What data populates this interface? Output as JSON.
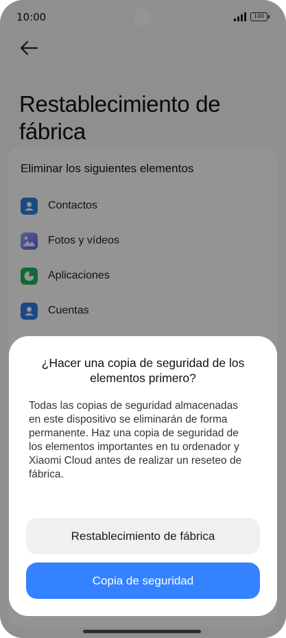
{
  "status_bar": {
    "time": "10:00",
    "battery": "100"
  },
  "header": {
    "title": "Restablecimiento de fábrica"
  },
  "section": {
    "heading": "Eliminar los siguientes elementos",
    "items": [
      {
        "label": "Contactos",
        "icon": "contacts-icon",
        "color": "#2f7fe3"
      },
      {
        "label": "Fotos y vídeos",
        "icon": "gallery-icon",
        "color": "#6b7bf0"
      },
      {
        "label": "Aplicaciones",
        "icon": "apps-icon",
        "color": "#1fb25a"
      },
      {
        "label": "Cuentas",
        "icon": "accounts-icon",
        "color": "#2f7fe3"
      }
    ]
  },
  "dialog": {
    "title": "¿Hacer una copia de seguridad de los elementos primero?",
    "message": "Todas las copias de seguridad almacenadas en este dispositivo se eliminarán de forma permanente. Haz una copia de seguridad de los elementos importantes en tu ordenador y Xiaomi Cloud antes de realizar un reseteo de fábrica.",
    "reset_label": "Restablecimiento de fábrica",
    "backup_label": "Copia de seguridad"
  },
  "colors": {
    "accent": "#3482ff"
  }
}
